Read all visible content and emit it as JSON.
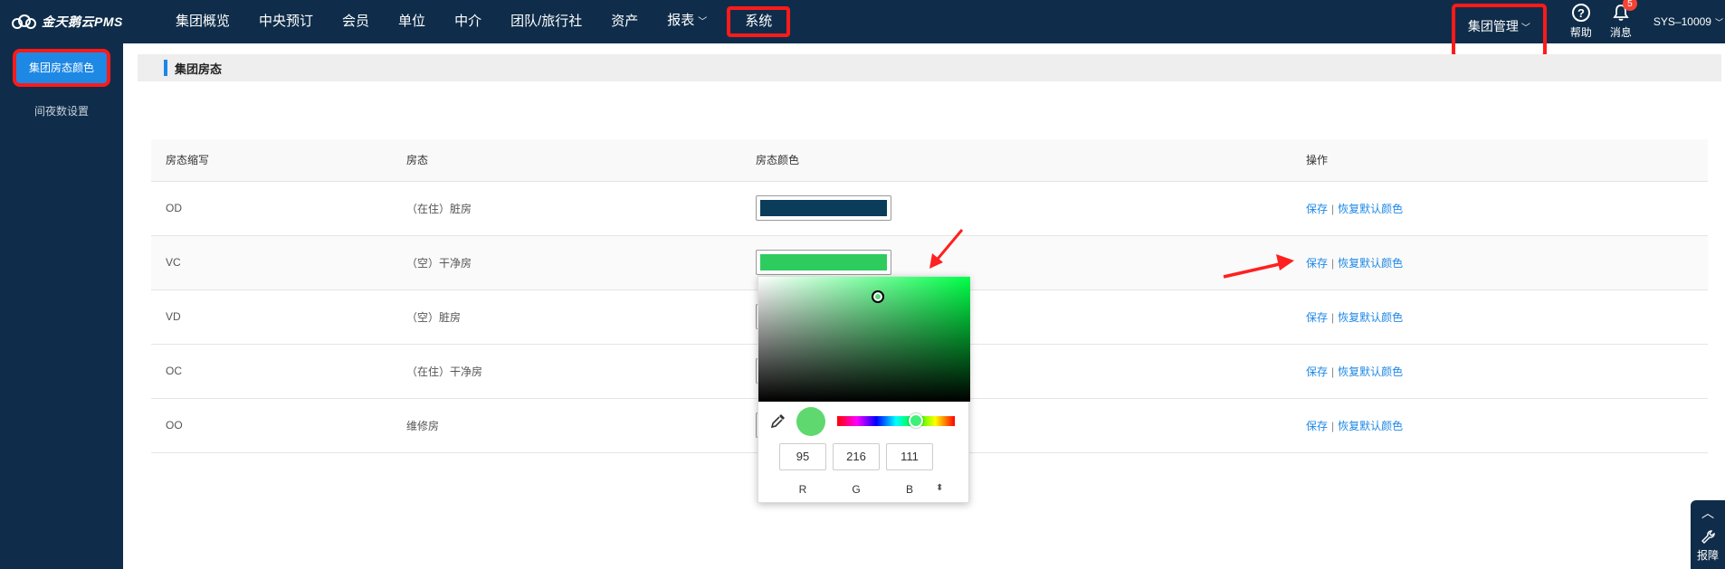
{
  "brand": {
    "logo_text": "金天鹅云PMS",
    "logo_icon": "cloud-logo-icon"
  },
  "nav": {
    "items": [
      {
        "label": "集团概览"
      },
      {
        "label": "中央预订"
      },
      {
        "label": "会员"
      },
      {
        "label": "单位"
      },
      {
        "label": "中介"
      },
      {
        "label": "团队/旅行社"
      },
      {
        "label": "资产"
      },
      {
        "label": "报表",
        "has_dropdown": true
      },
      {
        "label": "系统",
        "highlighted": true
      }
    ],
    "group_menu": {
      "label": "集团管理",
      "has_dropdown": true,
      "highlighted": true
    },
    "help_label": "帮助",
    "help_icon": "question-circle-icon",
    "message_label": "消息",
    "message_icon": "bell-icon",
    "message_badge": "5",
    "user": "SYS–10009"
  },
  "sidebar": {
    "items": [
      {
        "label": "集团房态颜色",
        "active": true,
        "highlighted": true
      },
      {
        "label": "间夜数设置",
        "active": false
      }
    ]
  },
  "section": {
    "title": "集团房态"
  },
  "table": {
    "headers": [
      "房态缩写",
      "房态",
      "房态颜色",
      "操作"
    ],
    "rows": [
      {
        "abbr": "OD",
        "status": "（在住）脏房",
        "color": "#0b3d5b"
      },
      {
        "abbr": "VC",
        "status": "（空）干净房",
        "color": "#2ecc5f"
      },
      {
        "abbr": "VD",
        "status": "（空）脏房",
        "color": "#f5f5f5"
      },
      {
        "abbr": "OC",
        "status": "（在住）干净房",
        "color": "#f5f5f5"
      },
      {
        "abbr": "OO",
        "status": "维修房",
        "color": "#f5f5f5"
      }
    ],
    "action_save": "保存",
    "action_separator": "|",
    "action_reset": "恢复默认颜色"
  },
  "color_picker": {
    "hue_color": "#00ff48",
    "preview_color": "#5fd86f",
    "r": "95",
    "g": "216",
    "b": "111",
    "r_label": "R",
    "g_label": "G",
    "b_label": "B",
    "toggle_icon": "up-down-icon",
    "eyedropper_icon": "eyedropper-icon"
  },
  "floating_widget": {
    "label": "报障",
    "up_icon": "chevron-up-icon",
    "wrench_icon": "wrench-icon"
  },
  "colors": {
    "nav_bg": "#0f2d4a",
    "accent": "#1e88e5",
    "highlight": "#ff1a1a"
  }
}
